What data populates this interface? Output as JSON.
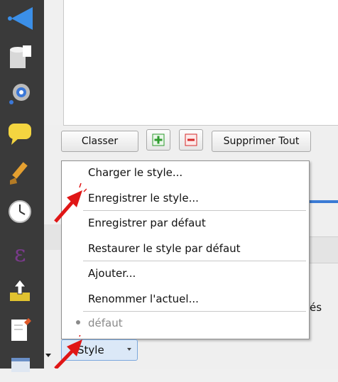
{
  "toolbar": {
    "classer_label": "Classer",
    "add_icon": "plus-icon",
    "remove_icon": "minus-icon",
    "supprimer_label": "Supprimer Tout"
  },
  "menu": {
    "items": [
      {
        "label": "Charger le style..."
      },
      {
        "label": "Enregistrer le style..."
      },
      {
        "label": "Enregistrer par défaut"
      },
      {
        "label": "Restaurer le style par défaut"
      },
      {
        "label": "Ajouter..."
      },
      {
        "label": "Renommer l'actuel..."
      },
      {
        "label": "défaut"
      }
    ]
  },
  "style_button": {
    "label": "Style"
  },
  "background_text": {
    "partial": "és"
  },
  "colors": {
    "sidebar": "#3a3a3a",
    "accent_blue": "#3a7bd5",
    "annotation_red": "#e01616",
    "plus_green": "#2e9b2e",
    "minus_red": "#d62a2a"
  },
  "sidebar_icons": [
    "collapse-arrow-icon",
    "database-icon",
    "processing-gear-icon",
    "speech-bubble-icon",
    "paintbrush-icon",
    "clock-icon",
    "epsilon-icon",
    "upload-icon",
    "document-edit-icon",
    "window-icon"
  ]
}
